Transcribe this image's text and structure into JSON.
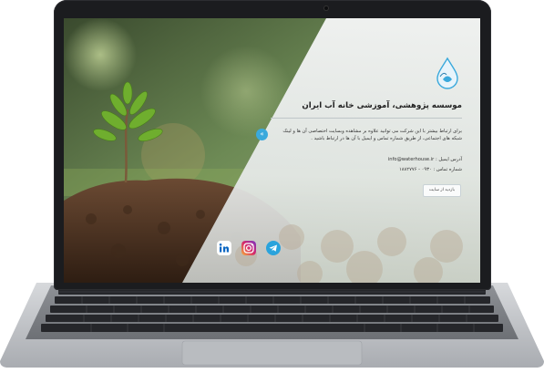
{
  "site": {
    "title": "موسسه پژوهشی، آموزشی خانه آب ایران",
    "description": "برای ارتباط بیشتر با این شرکت می توانید علاوه بر مشاهده وبسایت اختصاصی آن ها و لینک شبکه های اجتماعی، از طریق شماره تماس و ایمیل با آن ها در ارتباط باشید .",
    "email_label": "آدرس ایمیل :",
    "email_value": "info@waterhouse.ir",
    "phone_label": "شماره تماس :",
    "phone_value": "۰۹۳۰ - ۱۸۸۲۷۷۶",
    "visit_button": "بازدید از سایت"
  },
  "icons": {
    "logo": "water-drop-logo-icon",
    "arrow": "double-chevron-left-icon",
    "linkedin": "linkedin-icon",
    "instagram": "instagram-icon",
    "telegram": "telegram-icon"
  },
  "colors": {
    "accent": "#3aa9dc",
    "linkedin": "#0a66c2",
    "telegram": "#2aa3dc",
    "instagram": "#d6296b"
  }
}
